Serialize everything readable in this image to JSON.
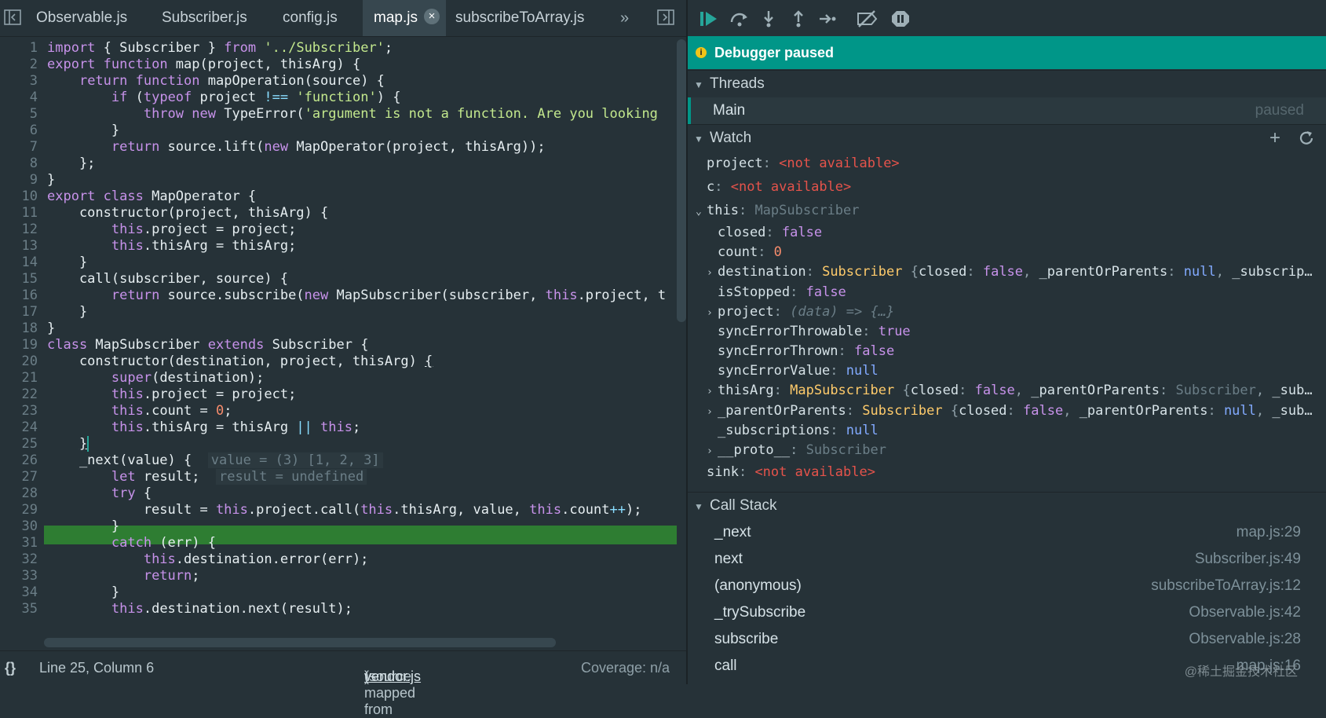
{
  "tabs": [
    {
      "label": "Observable.js"
    },
    {
      "label": "Subscriber.js"
    },
    {
      "label": "config.js"
    },
    {
      "label": "map.js",
      "active": true
    },
    {
      "label": "subscribeToArray.js"
    }
  ],
  "tab_close": "×",
  "tab_more": "»",
  "code": {
    "lines": [
      {
        "n": "1"
      },
      {
        "n": "2"
      },
      {
        "n": "3"
      },
      {
        "n": "4"
      },
      {
        "n": "5"
      },
      {
        "n": "6"
      },
      {
        "n": "7"
      },
      {
        "n": "8"
      },
      {
        "n": "9"
      },
      {
        "n": "10"
      },
      {
        "n": "11"
      },
      {
        "n": "12"
      },
      {
        "n": "13"
      },
      {
        "n": "14"
      },
      {
        "n": "15"
      },
      {
        "n": "16"
      },
      {
        "n": "17"
      },
      {
        "n": "18"
      },
      {
        "n": "19"
      },
      {
        "n": "20"
      },
      {
        "n": "21"
      },
      {
        "n": "22"
      },
      {
        "n": "23"
      },
      {
        "n": "24"
      },
      {
        "n": "25"
      },
      {
        "n": "26"
      },
      {
        "n": "27"
      },
      {
        "n": "28"
      },
      {
        "n": "29"
      },
      {
        "n": "30"
      },
      {
        "n": "31"
      },
      {
        "n": "32"
      },
      {
        "n": "33"
      },
      {
        "n": "34"
      },
      {
        "n": "35"
      }
    ],
    "highlighted_line": "29",
    "inline_values": {
      "value": "value = (3) [1, 2, 3]",
      "result": "result = undefined"
    }
  },
  "status": {
    "braces": "{}",
    "position": "Line 25, Column 6",
    "source_prefix": "(source mapped from ",
    "source_file": "vendor.js",
    "source_suffix": ")",
    "coverage": "Coverage: n/a"
  },
  "debugger": {
    "banner": "Debugger paused",
    "threads": {
      "title": "Threads",
      "items": [
        {
          "name": "Main",
          "state": "paused"
        }
      ]
    },
    "watch": {
      "title": "Watch",
      "not_available": "<not available>"
    },
    "call_stack": {
      "title": "Call Stack",
      "frames": [
        {
          "name": "_next",
          "location": "map.js:29"
        },
        {
          "name": "next",
          "location": "Subscriber.js:49"
        },
        {
          "name": "(anonymous)",
          "location": "subscribeToArray.js:12"
        },
        {
          "name": "_trySubscribe",
          "location": "Observable.js:42"
        },
        {
          "name": "subscribe",
          "location": "Observable.js:28"
        },
        {
          "name": "call",
          "location": "map.js:16"
        }
      ]
    }
  },
  "watermark": "@稀土掘金技术社区",
  "colors": {
    "accent": "#009688",
    "highlight_line": "#2e7d32",
    "background": "#263238"
  }
}
